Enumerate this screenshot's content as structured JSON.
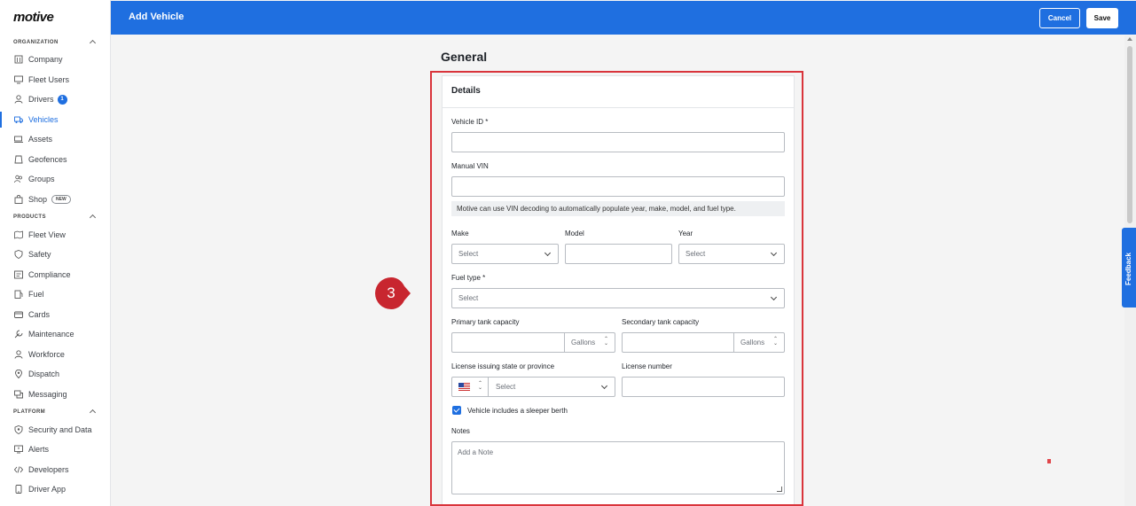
{
  "sidebar": {
    "logo": "motive",
    "sections": {
      "organization": "ORGANIZATION",
      "products": "PRODUCTS",
      "platform": "PLATFORM"
    },
    "items": {
      "company": "Company",
      "fleet_users": "Fleet Users",
      "drivers": "Drivers",
      "drivers_badge": "1",
      "vehicles": "Vehicles",
      "assets": "Assets",
      "geofences": "Geofences",
      "groups": "Groups",
      "shop": "Shop",
      "shop_pill": "NEW",
      "fleet_view": "Fleet View",
      "safety": "Safety",
      "compliance": "Compliance",
      "fuel": "Fuel",
      "cards": "Cards",
      "maintenance": "Maintenance",
      "workforce": "Workforce",
      "dispatch": "Dispatch",
      "messaging": "Messaging",
      "security_and_data": "Security and Data",
      "alerts": "Alerts",
      "developers": "Developers",
      "driver_app": "Driver App"
    },
    "active_item": "Vehicles"
  },
  "header": {
    "title": "Add Vehicle",
    "cancel_label": "Cancel",
    "save_label": "Save"
  },
  "main": {
    "section_title": "General",
    "card_title": "Details",
    "fields": {
      "vehicle_id": {
        "label": "Vehicle ID *",
        "value": ""
      },
      "manual_vin": {
        "label": "Manual VIN",
        "value": ""
      },
      "vin_hint": "Motive can use VIN decoding to automatically populate year, make, model, and fuel type.",
      "make": {
        "label": "Make",
        "value": "Select"
      },
      "model": {
        "label": "Model",
        "value": ""
      },
      "year": {
        "label": "Year",
        "value": "Select"
      },
      "fuel_type": {
        "label": "Fuel type *",
        "value": "Select"
      },
      "primary_tank": {
        "label": "Primary tank capacity",
        "value": "",
        "unit": "Gallons"
      },
      "secondary_tank": {
        "label": "Secondary tank capacity",
        "value": "",
        "unit": "Gallons"
      },
      "license_state": {
        "label": "License issuing state or province",
        "value": "Select"
      },
      "license_number": {
        "label": "License number",
        "value": ""
      },
      "sleeper_berth": {
        "label": "Vehicle includes a sleeper berth",
        "checked": true
      },
      "notes": {
        "label": "Notes",
        "placeholder": "Add a Note"
      }
    }
  },
  "step_marker": "3",
  "feedback_label": "Feedback",
  "colors": {
    "brand": "#1f6fe0",
    "highlight": "#d9343b"
  }
}
